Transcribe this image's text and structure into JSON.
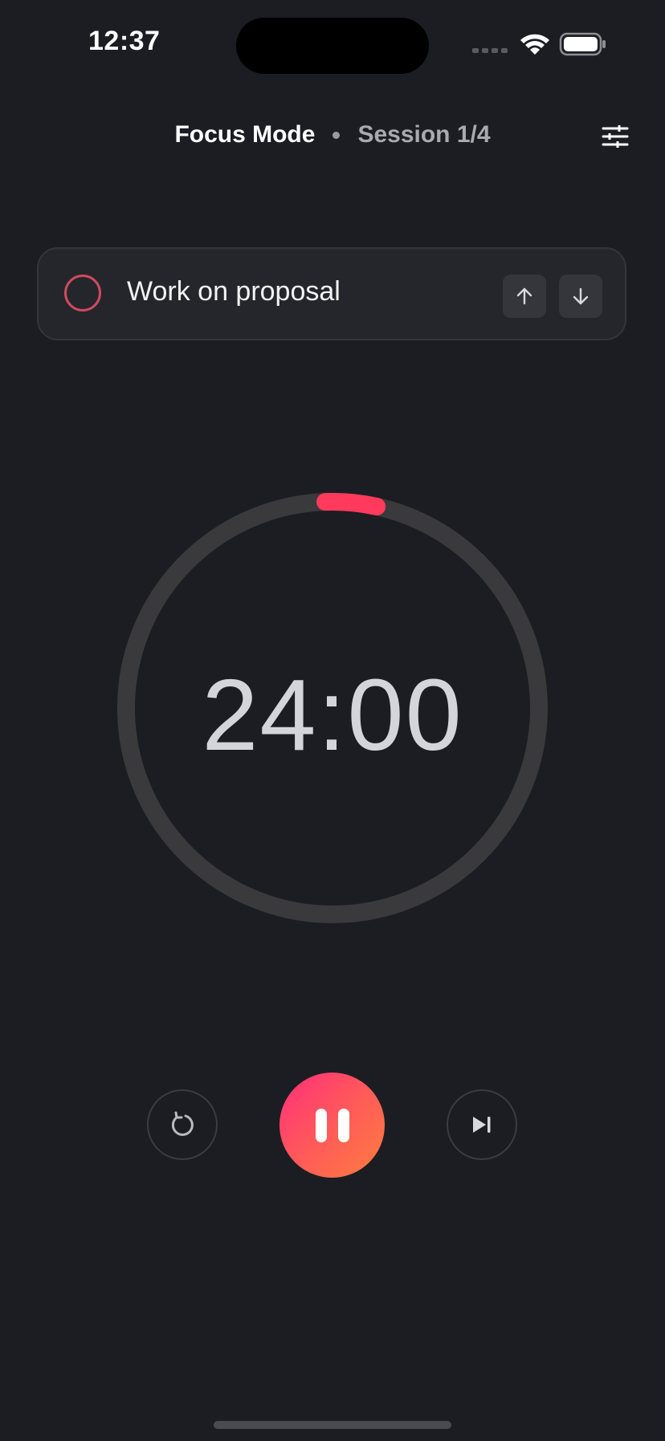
{
  "status_bar": {
    "time": "12:37",
    "icons": [
      "cellular-signal-icon",
      "wifi-icon",
      "battery-icon"
    ]
  },
  "header": {
    "title": "Focus Mode",
    "separator_icon": "dot-icon",
    "session": "Session 1/4",
    "settings_icon": "sliders-icon"
  },
  "task": {
    "label": "Work on proposal",
    "completed": false,
    "move_up_icon": "arrow-up-icon",
    "move_down_icon": "arrow-down-icon"
  },
  "timer": {
    "remaining": "24:00",
    "progress": 0.04
  },
  "controls": {
    "reset_icon": "reset-icon",
    "pause_icon": "pause-icon",
    "skip_icon": "skip-icon"
  },
  "colors": {
    "background": "#1c1d22",
    "card": "#25262b",
    "accent": "#ff3a5c",
    "ring_track": "#3a3a3c",
    "gradient_start": "#ff2e7a",
    "gradient_end": "#ff7d3e"
  }
}
